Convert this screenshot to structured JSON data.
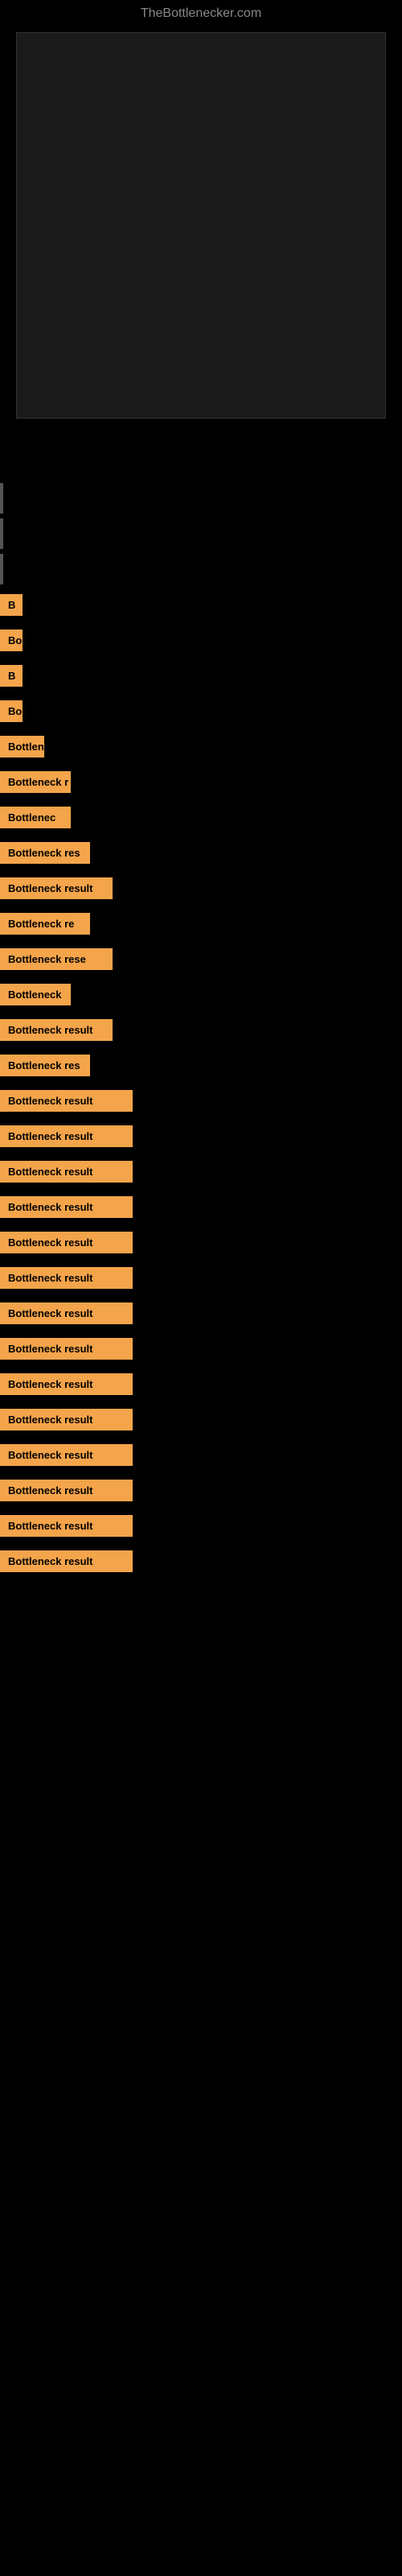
{
  "site": {
    "title": "TheBottlenecker.com"
  },
  "chart": {
    "visible": true
  },
  "results": [
    {
      "id": 1,
      "label": "",
      "size": "xs",
      "has_indicator": true
    },
    {
      "id": 2,
      "label": "",
      "size": "xs",
      "has_indicator": true
    },
    {
      "id": 3,
      "label": "",
      "size": "xs",
      "has_indicator": true
    },
    {
      "id": 4,
      "label": "B",
      "size": "sm",
      "has_indicator": false
    },
    {
      "id": 5,
      "label": "Bo",
      "size": "sm",
      "has_indicator": false
    },
    {
      "id": 6,
      "label": "B",
      "size": "sm",
      "has_indicator": false
    },
    {
      "id": 7,
      "label": "Bo",
      "size": "sm",
      "has_indicator": false
    },
    {
      "id": 8,
      "label": "Bottlen",
      "size": "md",
      "has_indicator": false
    },
    {
      "id": 9,
      "label": "Bottleneck r",
      "size": "lg",
      "has_indicator": false
    },
    {
      "id": 10,
      "label": "Bottlenec",
      "size": "lg",
      "has_indicator": false
    },
    {
      "id": 11,
      "label": "Bottleneck res",
      "size": "xl",
      "has_indicator": false
    },
    {
      "id": 12,
      "label": "Bottleneck result",
      "size": "xxl",
      "has_indicator": false
    },
    {
      "id": 13,
      "label": "Bottleneck re",
      "size": "xl",
      "has_indicator": false
    },
    {
      "id": 14,
      "label": "Bottleneck rese",
      "size": "xxl",
      "has_indicator": false
    },
    {
      "id": 15,
      "label": "Bottleneck",
      "size": "lg",
      "has_indicator": false
    },
    {
      "id": 16,
      "label": "Bottleneck result",
      "size": "xxl",
      "has_indicator": false
    },
    {
      "id": 17,
      "label": "Bottleneck res",
      "size": "xl",
      "has_indicator": false
    },
    {
      "id": 18,
      "label": "Bottleneck result",
      "size": "full",
      "has_indicator": false
    },
    {
      "id": 19,
      "label": "Bottleneck result",
      "size": "full",
      "has_indicator": false
    },
    {
      "id": 20,
      "label": "Bottleneck result",
      "size": "full",
      "has_indicator": false
    },
    {
      "id": 21,
      "label": "Bottleneck result",
      "size": "full",
      "has_indicator": false
    },
    {
      "id": 22,
      "label": "Bottleneck result",
      "size": "full",
      "has_indicator": false
    },
    {
      "id": 23,
      "label": "Bottleneck result",
      "size": "full",
      "has_indicator": false
    },
    {
      "id": 24,
      "label": "Bottleneck result",
      "size": "full",
      "has_indicator": false
    },
    {
      "id": 25,
      "label": "Bottleneck result",
      "size": "full",
      "has_indicator": false
    },
    {
      "id": 26,
      "label": "Bottleneck result",
      "size": "full",
      "has_indicator": false
    },
    {
      "id": 27,
      "label": "Bottleneck result",
      "size": "full",
      "has_indicator": false
    },
    {
      "id": 28,
      "label": "Bottleneck result",
      "size": "full",
      "has_indicator": false
    },
    {
      "id": 29,
      "label": "Bottleneck result",
      "size": "full",
      "has_indicator": false
    },
    {
      "id": 30,
      "label": "Bottleneck result",
      "size": "full",
      "has_indicator": false
    },
    {
      "id": 31,
      "label": "Bottleneck result",
      "size": "full",
      "has_indicator": false
    }
  ]
}
